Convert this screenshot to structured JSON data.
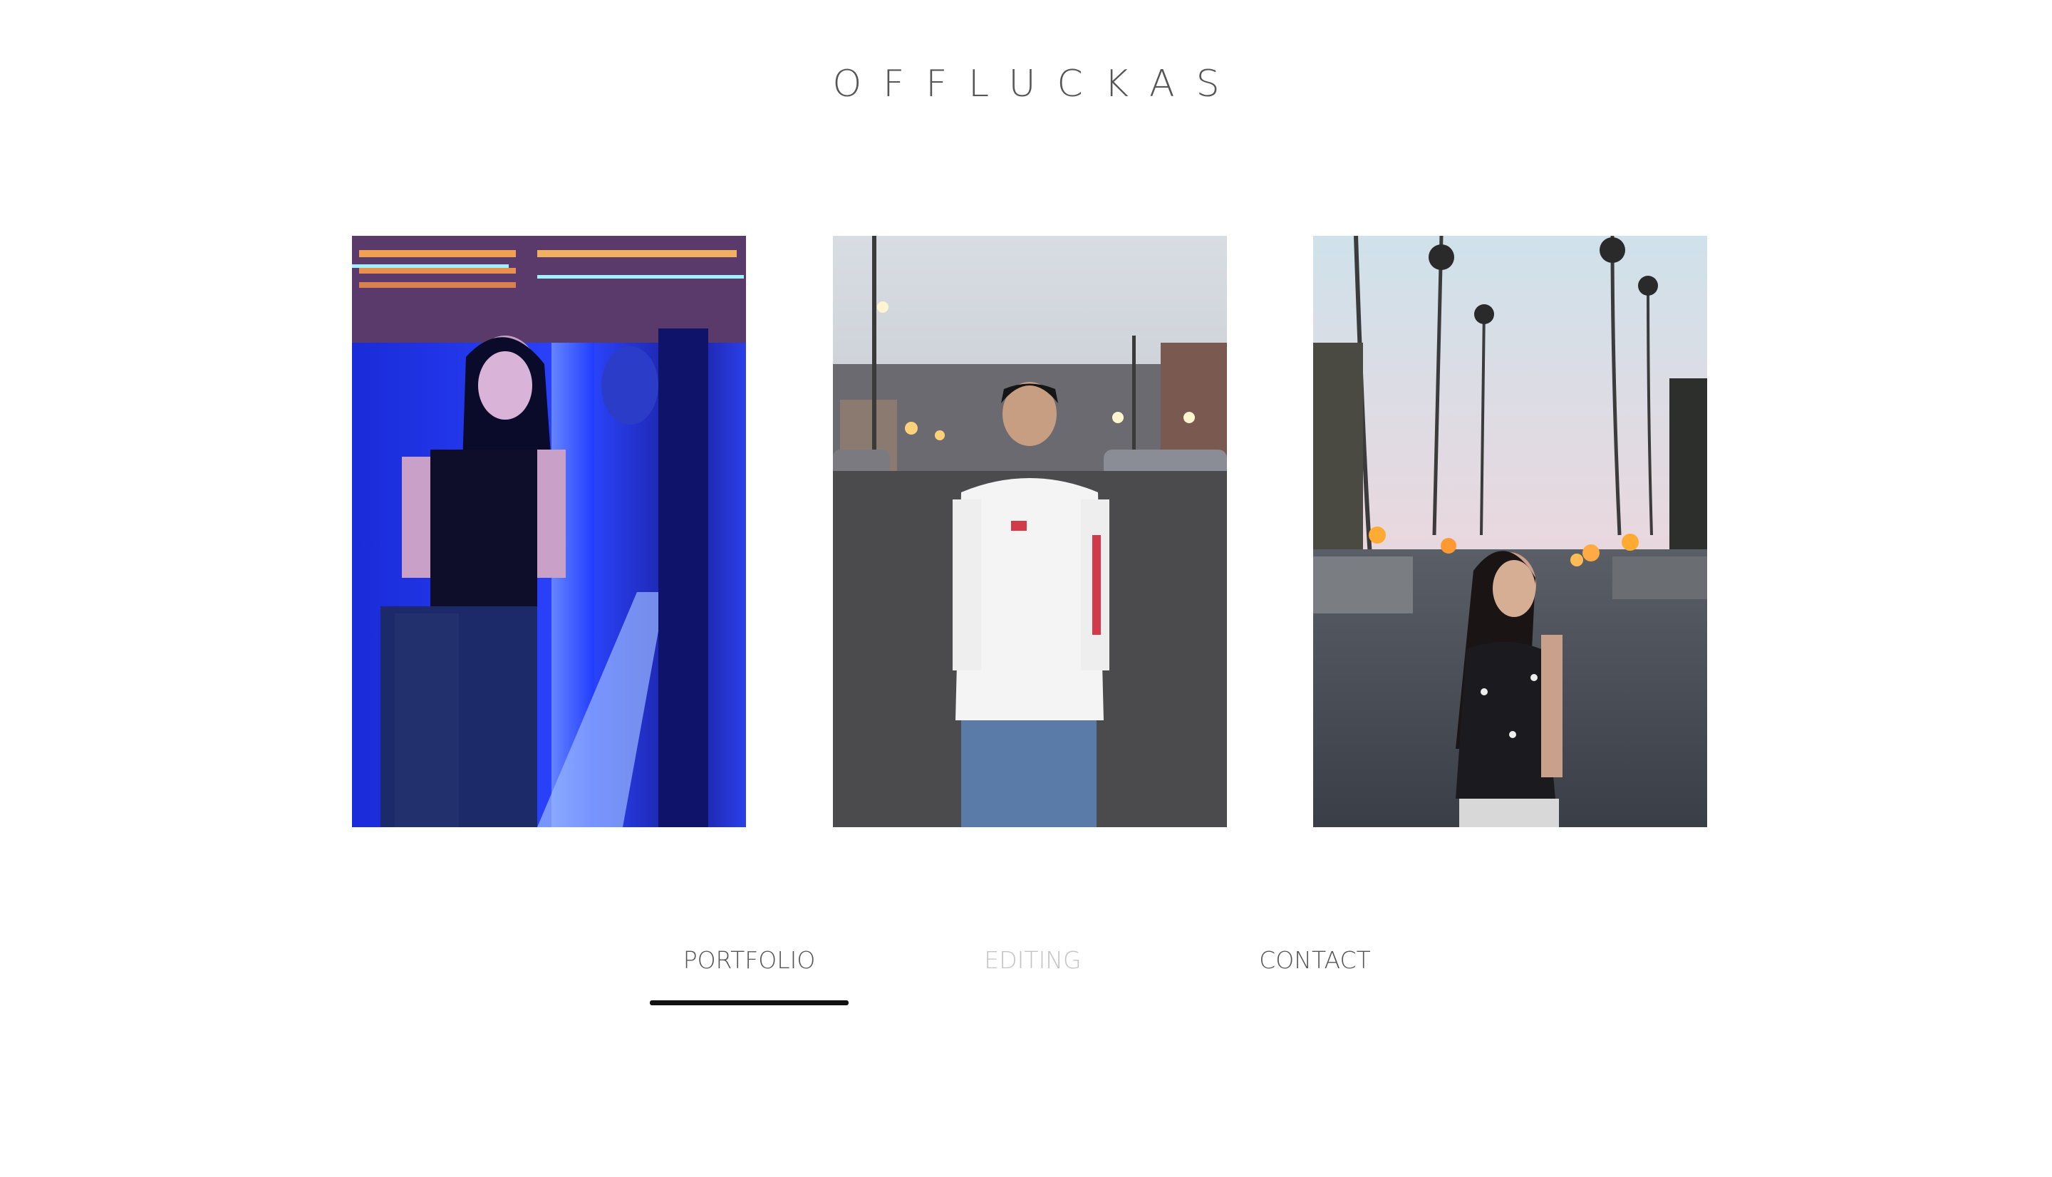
{
  "header": {
    "title": "OFFLUCKAS"
  },
  "gallery": {
    "photos": [
      {
        "icon": "portrait-photo-neon-blue",
        "accent": "#2a3ff0"
      },
      {
        "icon": "portrait-photo-street-dusk",
        "accent": "#5a5a5a"
      },
      {
        "icon": "portrait-photo-palm-street",
        "accent": "#e8a05a"
      }
    ]
  },
  "nav": {
    "items": [
      {
        "label": "PORTFOLIO",
        "active": true
      },
      {
        "label": "EDITING",
        "active": false
      },
      {
        "label": "CONTACT",
        "active": false
      }
    ]
  },
  "colors": {
    "background": "#ffffff",
    "text": "#555555",
    "faded_text": "#c4c4c4",
    "underline": "#111111"
  }
}
